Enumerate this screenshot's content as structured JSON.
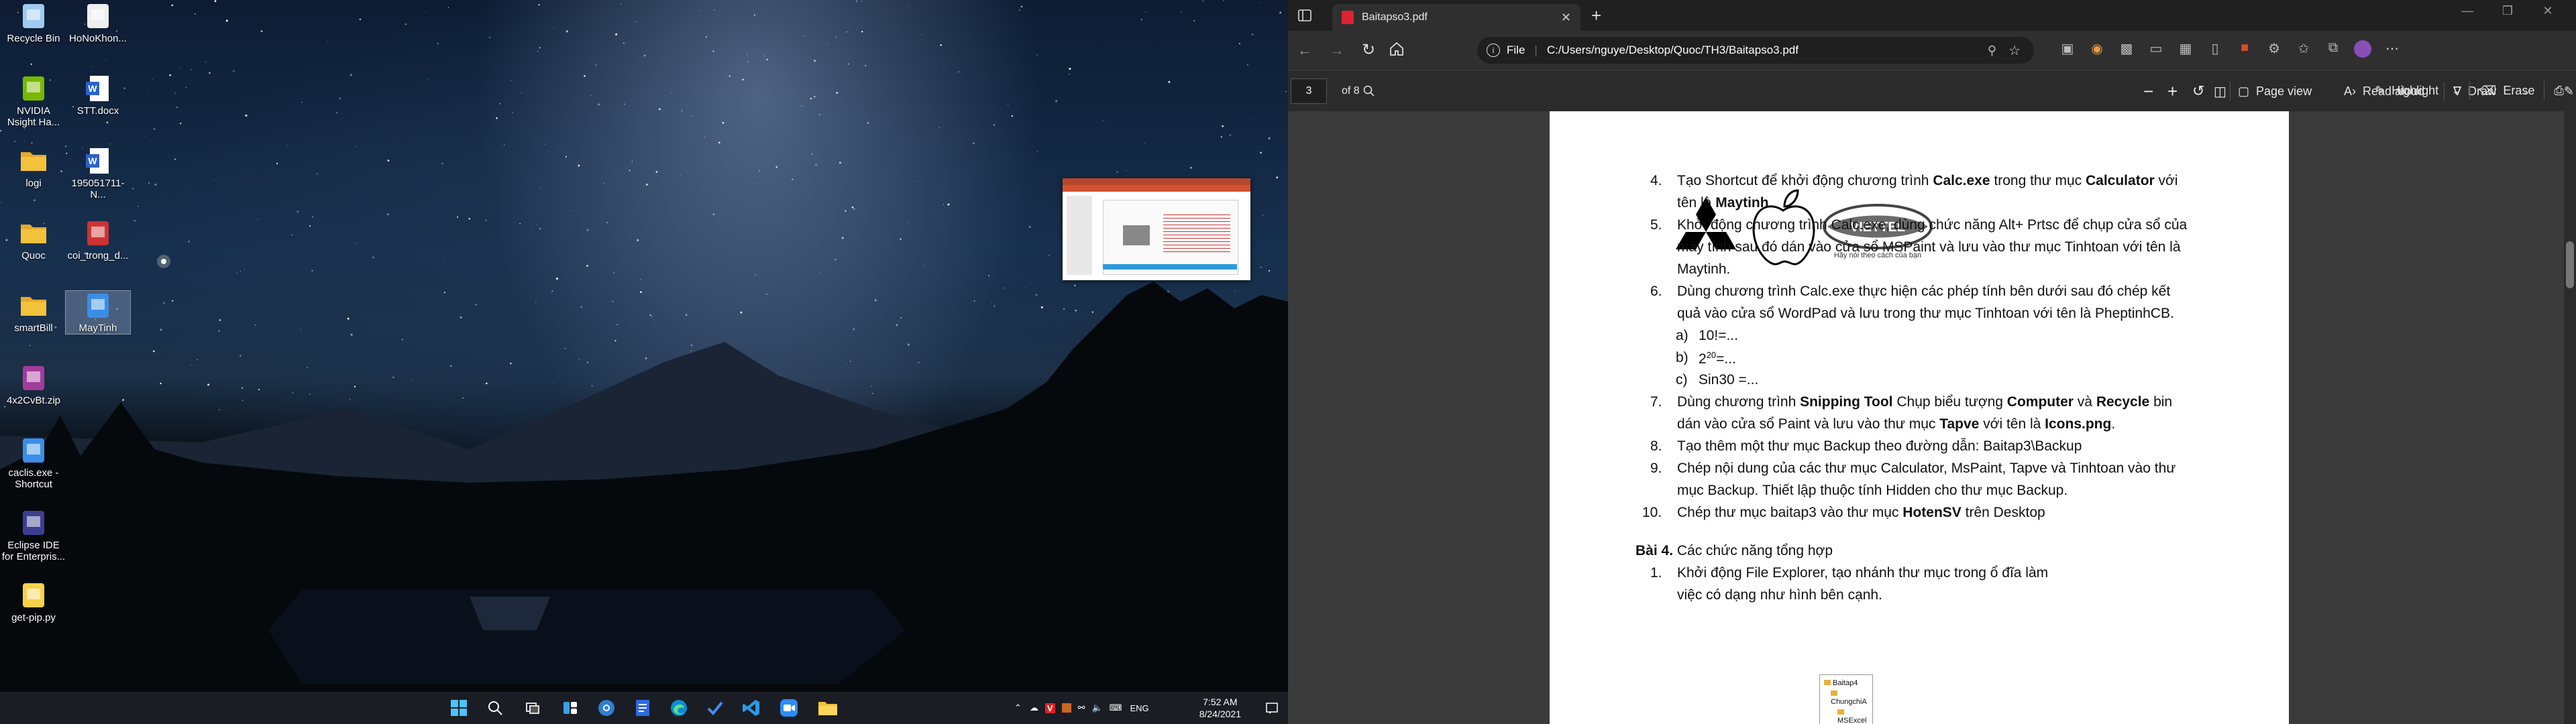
{
  "desktop": {
    "icons": [
      {
        "label": "Recycle Bin",
        "icon": "recycle-bin-icon"
      },
      {
        "label": "HoNoKhon...",
        "icon": "piano-icon"
      },
      {
        "label": "NVIDIA\nNsight Ha...",
        "icon": "nvidia-icon"
      },
      {
        "label": "STT.docx",
        "icon": "word-doc-icon"
      },
      {
        "label": "logi",
        "icon": "folder-icon"
      },
      {
        "label": "195051711-N...",
        "icon": "word-doc-icon"
      },
      {
        "label": "Quoc",
        "icon": "folder-icon"
      },
      {
        "label": "coi_trong_d...",
        "icon": "image-file-icon"
      },
      {
        "label": "smartBill",
        "icon": "folder-icon"
      },
      {
        "label": "MayTinh",
        "icon": "shortcut-icon"
      },
      {
        "label": "4x2CvBt.zip",
        "icon": "zip-icon"
      },
      {
        "label": "caclis.exe -\nShortcut",
        "icon": "shortcut-icon"
      },
      {
        "label": "Eclipse IDE\nfor Enterpris...",
        "icon": "eclipse-icon"
      },
      {
        "label": "get-pip.py",
        "icon": "python-file-icon"
      }
    ]
  },
  "taskbar": {
    "clock_time": "7:52 AM",
    "clock_date": "8/24/2021",
    "language": "ENG"
  },
  "browser": {
    "tab_title": "Baitapso3.pdf",
    "address_prefix": "File",
    "address_url": "C:/Users/nguye/Desktop/Quoc/TH3/Baitapso3.pdf",
    "pdf_toolbar": {
      "page_current": "3",
      "page_total": "of 8",
      "page_view": "Page view",
      "read_aloud": "Read aloud",
      "draw": "Draw",
      "highlight": "Highlight",
      "erase": "Erase"
    }
  },
  "document": {
    "logo_text": "VIETTEL",
    "logo_slogan": "Hãy nói theo cách của bạn",
    "items": [
      {
        "num": "4.",
        "parts": [
          "Tạo Shortcut để khởi động chương trình ",
          "Calc.exe",
          " trong thư mục ",
          "Calculator",
          " với"
        ],
        "cont": [
          "tên là ",
          "Maytinh",
          "."
        ]
      },
      {
        "num": "5.",
        "text1": "Khởi động chương trình Calc.exe, dùng chức năng Alt+ Prtsc để chụp cửa sổ của",
        "text2": "máy tính sau đó dán vào cửa sổ MSPaint và lưu vào thư mục Tinhtoan với tên là",
        "text3": "Maytinh."
      },
      {
        "num": "6.",
        "text1": "Dùng chương trình Calc.exe thực hiện các phép tính bên dưới sau đó chép kết",
        "text2": "quả vào cửa sổ WordPad và lưu trong thư mục Tinhtoan với tên là PheptinhCB."
      },
      {
        "num": "a)",
        "text1": "10!=..."
      },
      {
        "num": "b)",
        "text1": "2",
        "sup": "20",
        "text2": "=..."
      },
      {
        "num": "c)",
        "text1": "Sin30 =..."
      },
      {
        "num": "7.",
        "parts": [
          "Dùng chương trình ",
          "Snipping Tool",
          " Chụp biểu tượng ",
          "Computer",
          " và ",
          "Recycle",
          " bin"
        ],
        "cont": [
          "dán vào cửa sổ Paint và lưu vào thư mục ",
          "Tapve",
          " với tên là ",
          "Icons.png",
          "."
        ]
      },
      {
        "num": "8.",
        "text1": "Tạo thêm một thư mục Backup theo đường dẫn: Baitap3\\Backup"
      },
      {
        "num": "9.",
        "text1": "Chép nội dung của các thư mục Calculator, MsPaint, Tapve và Tinhtoan vào thư",
        "text2": "mục Backup. Thiết lập thuộc tính Hidden cho thư mục Backup."
      },
      {
        "num": "10.",
        "parts": [
          "Chép thư mục baitap3 vào thư mục ",
          "HotenSV",
          " trên Desktop"
        ]
      }
    ],
    "section": {
      "title_bold": "Bài 4.",
      "title_rest": " Các chức năng tổng hợp"
    },
    "item_b4_1": {
      "num": "1.",
      "text1": "Khởi động File Explorer, tạo nhánh thư mục trong ổ đĩa làm",
      "text2": "việc có dạng như hình bên cạnh."
    },
    "tree": [
      "Baitap4",
      "ChungchiA",
      "MSExcel"
    ]
  }
}
